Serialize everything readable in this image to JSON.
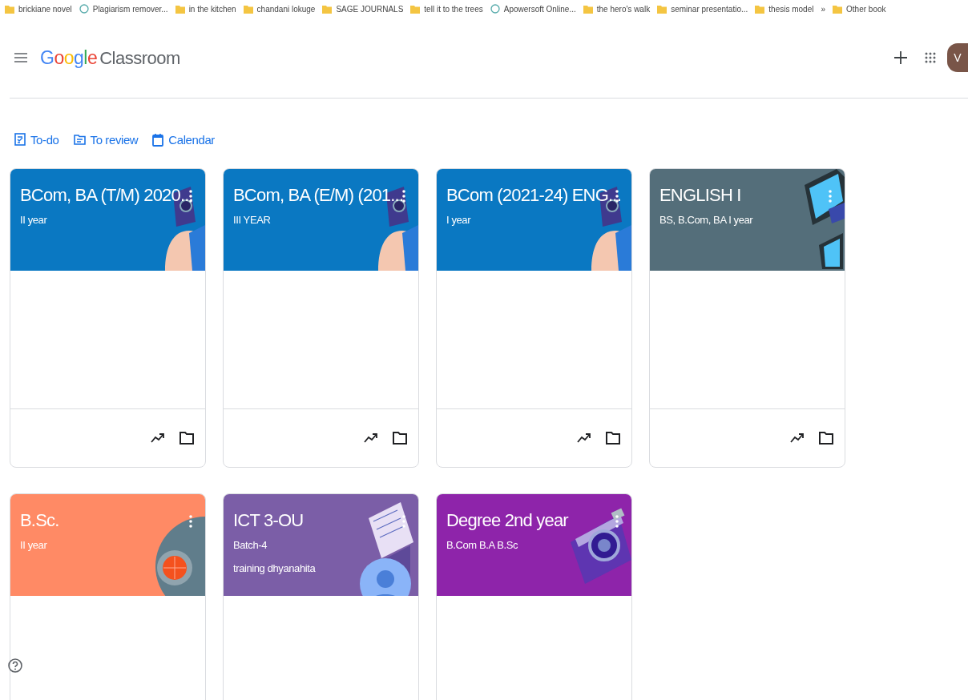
{
  "bookmarks": [
    {
      "label": "brickiane novel",
      "kind": "folder"
    },
    {
      "label": "Plagiarism remover...",
      "kind": "site"
    },
    {
      "label": "in the kitchen",
      "kind": "folder"
    },
    {
      "label": "chandani lokuge",
      "kind": "folder"
    },
    {
      "label": "SAGE JOURNALS",
      "kind": "folder"
    },
    {
      "label": "tell it to the trees",
      "kind": "folder"
    },
    {
      "label": "Apowersoft Online...",
      "kind": "site"
    },
    {
      "label": "the hero's walk",
      "kind": "folder"
    },
    {
      "label": "seminar presentatio...",
      "kind": "folder"
    },
    {
      "label": "thesis model",
      "kind": "folder"
    }
  ],
  "bookmarks_more": "»",
  "other_bookmarks": "Other book",
  "app": {
    "logo_brand": "Google",
    "logo_product": "Classroom",
    "avatar_letter": "V"
  },
  "nav_links": [
    {
      "label": "To-do",
      "kind": "todo"
    },
    {
      "label": "To review",
      "kind": "review"
    },
    {
      "label": "Calendar",
      "kind": "calendar"
    }
  ],
  "classes": [
    {
      "title": "BCom, BA (T/M) 2020...",
      "subtitle": "II year",
      "color": "#0a78c2",
      "kind": "robot",
      "footer": true
    },
    {
      "title": "BCom, BA (E/M) (201...",
      "subtitle": "III YEAR",
      "color": "#0a78c2",
      "kind": "robot",
      "footer": true
    },
    {
      "title": "BCom (2021-24) ENG...",
      "subtitle": "I year",
      "color": "#0a78c2",
      "kind": "robot",
      "footer": true
    },
    {
      "title": "ENGLISH I",
      "subtitle": "BS, B.Com, BA I year",
      "color": "#546e7a",
      "kind": "tablet",
      "footer": true
    },
    {
      "title": "B.Sc.",
      "subtitle": "II year",
      "color": "#ff8a65",
      "kind": "clock",
      "footer": false
    },
    {
      "title": "ICT 3-OU",
      "subtitle": "Batch-4",
      "owner": "training dhyanahita",
      "color": "#7b5ea7",
      "kind": "notebook",
      "footer": false
    },
    {
      "title": "Degree 2nd year",
      "subtitle": "B.Com B.A B.Sc",
      "color": "#8e24aa",
      "kind": "camera",
      "footer": false
    }
  ]
}
